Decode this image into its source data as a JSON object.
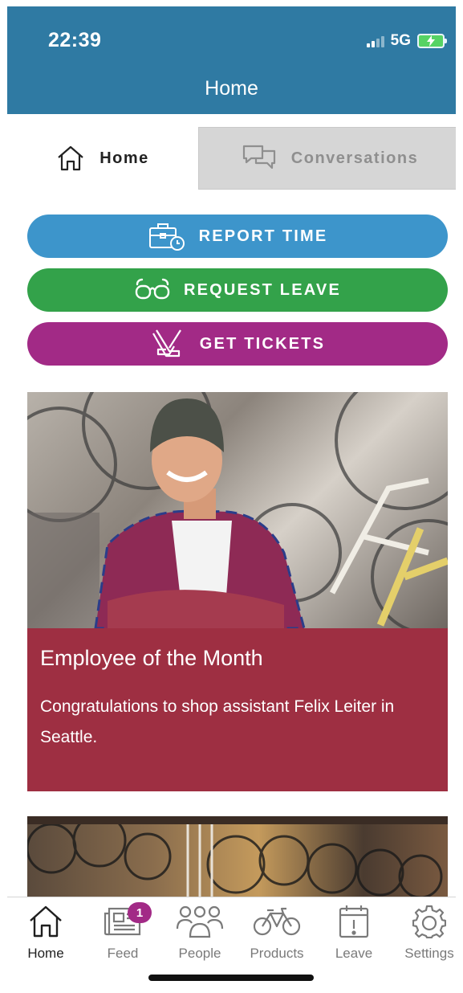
{
  "status": {
    "time": "22:39",
    "network": "5G"
  },
  "header": {
    "title": "Home"
  },
  "tabs": [
    {
      "label": "Home",
      "icon": "home-icon",
      "active": true
    },
    {
      "label": "Conversations",
      "icon": "chat-bubbles-icon",
      "active": false
    }
  ],
  "actions": [
    {
      "label": "REPORT TIME",
      "icon": "briefcase-clock-icon",
      "color": "#3d95cb"
    },
    {
      "label": "REQUEST LEAVE",
      "icon": "glasses-icon",
      "color": "#33a24a"
    },
    {
      "label": "GET TICKETS",
      "icon": "hockey-sticks-icon",
      "color": "#a22a86"
    }
  ],
  "featured": {
    "title": "Employee of the Month",
    "text": "Congratulations to shop assistant Felix Leiter in Seattle.",
    "color": "#9e2f42"
  },
  "bottom_nav": [
    {
      "label": "Home",
      "icon": "home-icon",
      "active": true
    },
    {
      "label": "Feed",
      "icon": "newspaper-icon",
      "badge": "1"
    },
    {
      "label": "People",
      "icon": "people-icon"
    },
    {
      "label": "Products",
      "icon": "bicycle-icon"
    },
    {
      "label": "Leave",
      "icon": "calendar-alert-icon"
    },
    {
      "label": "Settings",
      "icon": "gear-icon"
    }
  ],
  "colors": {
    "header": "#2f7aa3",
    "accent": "#a22a86"
  }
}
